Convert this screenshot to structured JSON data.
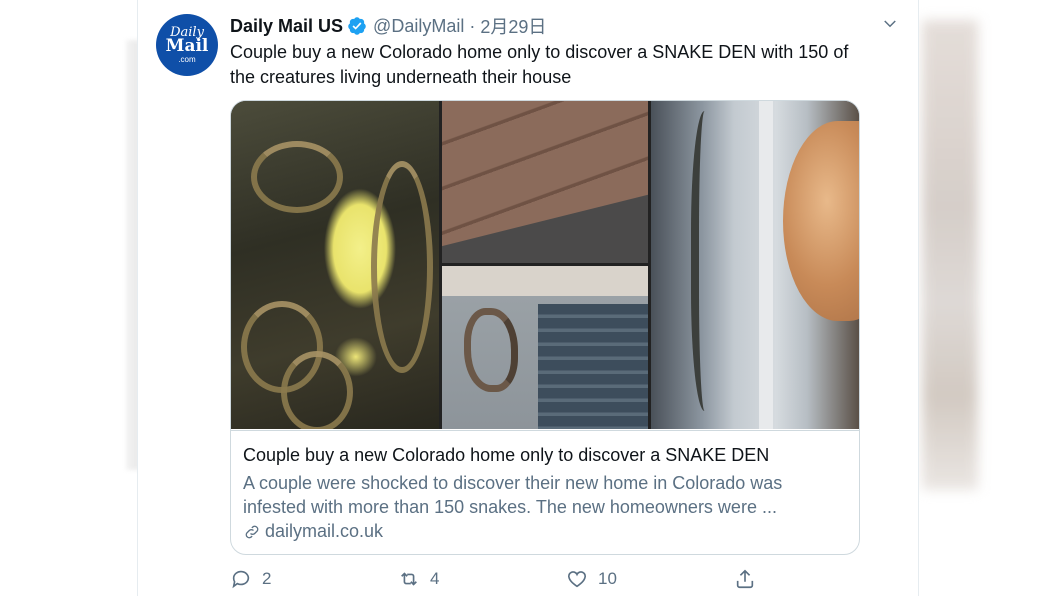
{
  "account": {
    "display_name": "Daily Mail US",
    "handle": "@DailyMail",
    "date": "2月29日",
    "avatar_text": [
      "Daily",
      "Mail",
      ".com"
    ]
  },
  "tweet": {
    "text": "Couple buy a new Colorado home only to discover a SNAKE DEN with 150 of the creatures living underneath their house"
  },
  "card": {
    "title": "Couple buy a new Colorado home only to discover a SNAKE DEN",
    "description": "A couple were shocked to discover their new home in Colorado was infested with more than 150 snakes. The new homeowners were ...",
    "domain": "dailymail.co.uk"
  },
  "actions": {
    "replies": "2",
    "retweets": "4",
    "likes": "10"
  },
  "icons": {
    "verified": "verified-badge-icon",
    "more": "chevron-down-icon",
    "reply": "reply-icon",
    "retweet": "retweet-icon",
    "like": "heart-icon",
    "share": "share-icon",
    "link": "link-icon"
  },
  "colors": {
    "verified": "#1da1f2",
    "text_primary": "#0f1419",
    "text_secondary": "#5b7083",
    "avatar_bg": "#0f4fa8",
    "border": "#cfd9de"
  }
}
